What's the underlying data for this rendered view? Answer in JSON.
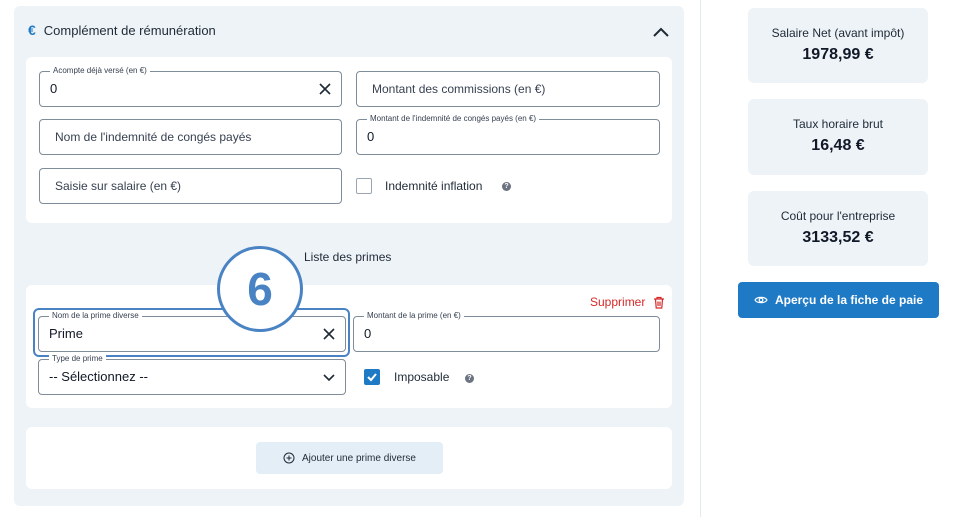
{
  "section": {
    "icon": "euro-icon",
    "title": "Complément de rémunération",
    "collapse_icon": "chevron-up-icon"
  },
  "fields": {
    "acompte": {
      "legend": "Acompte déjà versé (en €)",
      "value": "0"
    },
    "commissions": {
      "placeholder": "Montant des commissions (en €)"
    },
    "conges_nom": {
      "placeholder": "Nom de l'indemnité de congés payés"
    },
    "conges_montant": {
      "legend": "Montant de l'indemnité de congés payés (en €)",
      "value": "0"
    },
    "saisie": {
      "placeholder": "Saisie sur salaire (en €)"
    },
    "inflation": {
      "label": "Indemnité inflation",
      "checked": false,
      "help_icon": "help-icon"
    }
  },
  "primes": {
    "title": "Liste des primes",
    "step_number": "6",
    "delete_label": "Supprimer",
    "delete_icon": "trash-icon",
    "item": {
      "nom": {
        "legend": "Nom de la prime diverse",
        "value": "Prime"
      },
      "montant": {
        "legend": "Montant de la prime (en €)",
        "value": "0"
      },
      "type": {
        "legend": "Type de prime",
        "selected": "-- Sélectionnez --"
      },
      "imposable": {
        "label": "Imposable",
        "checked": true,
        "help_icon": "help-icon"
      }
    },
    "add_label": "Ajouter une prime diverse",
    "add_icon": "plus-circle-icon"
  },
  "summary": {
    "net": {
      "label": "Salaire Net (avant impôt)",
      "value": "1978,99 €"
    },
    "taux": {
      "label": "Taux horaire brut",
      "value": "16,48 €"
    },
    "cout": {
      "label": "Coût pour l'entreprise",
      "value": "3133,52 €"
    }
  },
  "preview_button": {
    "label": "Aperçu de la fiche de paie",
    "icon": "eye-icon"
  },
  "colors": {
    "accent": "#1f7ac6",
    "danger": "#d62828",
    "panel": "#eef3f7",
    "highlight": "#4a83c4"
  }
}
